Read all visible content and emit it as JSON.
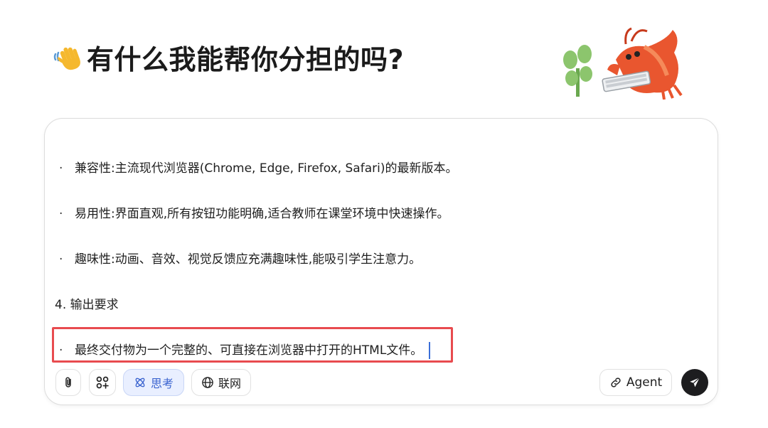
{
  "header": {
    "wave_icon": "waving-hand-icon",
    "title": "有什么我能帮你分担的吗?",
    "mascot": "lobster-typing-mascot"
  },
  "composer": {
    "lines": [
      {
        "bullet": "·",
        "text": "兼容性:主流现代浏览器(Chrome, Edge, Firefox, Safari)的最新版本。"
      },
      {
        "bullet": "·",
        "text": "易用性:界面直观,所有按钮功能明确,适合教师在课堂环境中快速操作。"
      },
      {
        "bullet": "·",
        "text": "趣味性:动画、音效、视觉反馈应充满趣味性,能吸引学生注意力。"
      },
      {
        "bullet": "",
        "text": "4. 输出要求"
      },
      {
        "bullet": "·",
        "text": "最终交付物为一个完整的、可直接在浏览器中打开的HTML文件。"
      }
    ],
    "highlight_color": "#e84b4f"
  },
  "toolbar": {
    "attach_icon": "paperclip-icon",
    "apps_icon": "apps-plus-icon",
    "think_label": "思考",
    "think_icon": "atom-icon",
    "web_label": "联网",
    "web_icon": "globe-icon",
    "agent_label": "Agent",
    "agent_icon": "link-icon",
    "send_icon": "paper-plane-icon",
    "accent": "#3a63cf"
  }
}
